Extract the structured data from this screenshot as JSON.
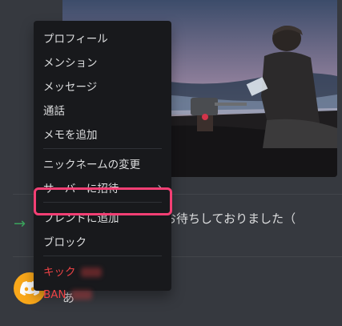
{
  "menu": {
    "items": [
      {
        "id": "profile",
        "label": "プロフィール"
      },
      {
        "id": "mention",
        "label": "メンション"
      },
      {
        "id": "message",
        "label": "メッセージ"
      },
      {
        "id": "call",
        "label": "通話"
      },
      {
        "id": "add-note",
        "label": "メモを追加"
      },
      {
        "id": "change-nickname",
        "label": "ニックネームの変更"
      },
      {
        "id": "invite-to-server",
        "label": "サーバーに招待"
      },
      {
        "id": "add-friend",
        "label": "フレンドに追加"
      },
      {
        "id": "block",
        "label": "ブロック"
      },
      {
        "id": "kick",
        "label": "キック"
      },
      {
        "id": "ban",
        "label": "BAN"
      }
    ]
  },
  "chat": {
    "join_message": "お待ちしておりました（",
    "message_text": "あ"
  },
  "colors": {
    "highlight": "#f43f74",
    "danger": "#ed4245",
    "join_arrow": "#3ba55d",
    "avatar": "#faa81a"
  },
  "icons": {
    "join": "arrow-right-icon",
    "submenu": "chevron-right-icon",
    "avatar": "discord-logo-icon"
  }
}
